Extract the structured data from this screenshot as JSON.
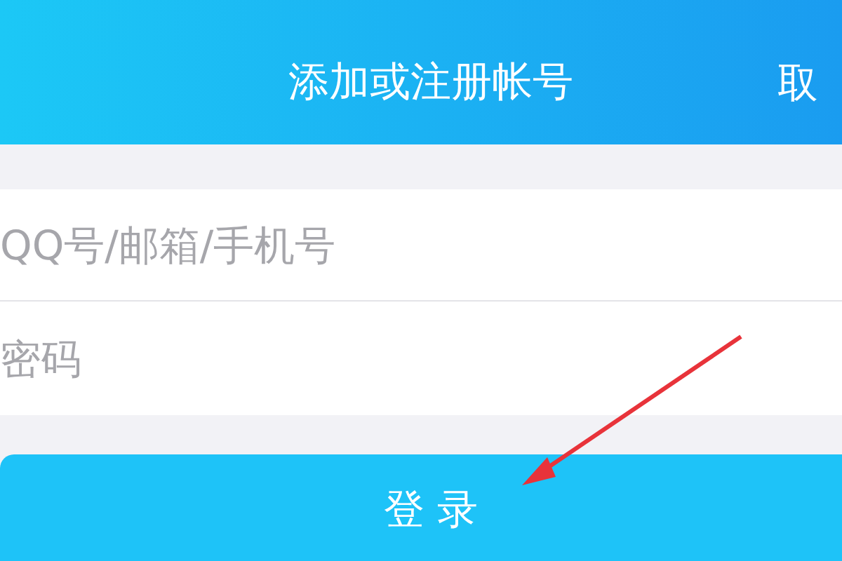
{
  "header": {
    "title": "添加或注册帐号",
    "cancel": "取"
  },
  "fields": [
    {
      "placeholder": "QQ号/邮箱/手机号"
    },
    {
      "placeholder": "密码"
    }
  ],
  "login_button": {
    "label": "登 录"
  }
}
